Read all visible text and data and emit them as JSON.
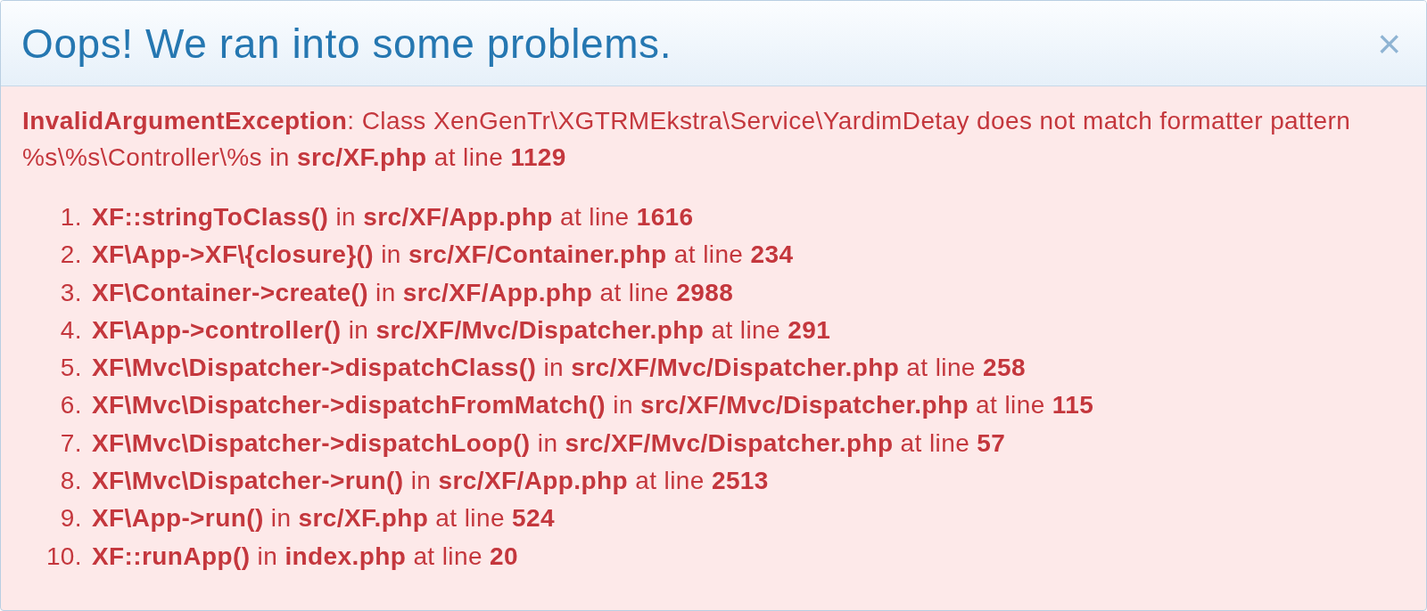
{
  "dialog": {
    "title": "Oops! We ran into some problems.",
    "close": "×",
    "message": "**InvalidArgumentException**: Class XenGenTr\\XGTRMEkstra\\Service\\YardimDetay does not match formatter pattern %s\\%s\\Controller\\%s in **src/XF.php** at line **1129**",
    "trace": [
      {
        "number": "1.",
        "text": "**XF::stringToClass()** in **src/XF/App.php** at line **1616**"
      },
      {
        "number": "2.",
        "text": "**XF\\App->XF\\{closure}()** in **src/XF/Container.php** at line **234**"
      },
      {
        "number": "3.",
        "text": "**XF\\Container->create()** in **src/XF/App.php** at line **2988**"
      },
      {
        "number": "4.",
        "text": "**XF\\App->controller()** in **src/XF/Mvc/Dispatcher.php** at line **291**"
      },
      {
        "number": "5.",
        "text": "**XF\\Mvc\\Dispatcher->dispatchClass()** in **src/XF/Mvc/Dispatcher.php** at line **258**"
      },
      {
        "number": "6.",
        "text": "**XF\\Mvc\\Dispatcher->dispatchFromMatch()** in **src/XF/Mvc/Dispatcher.php** at line **115**"
      },
      {
        "number": "7.",
        "text": "**XF\\Mvc\\Dispatcher->dispatchLoop()** in **src/XF/Mvc/Dispatcher.php** at line **57**"
      },
      {
        "number": "8.",
        "text": "**XF\\Mvc\\Dispatcher->run()** in **src/XF/App.php** at line **2513**"
      },
      {
        "number": "9.",
        "text": "**XF\\App->run()** in **src/XF.php** at line **524**"
      },
      {
        "number": "10.",
        "text": "**XF::runApp()** in **index.php** at line **20**"
      }
    ]
  }
}
